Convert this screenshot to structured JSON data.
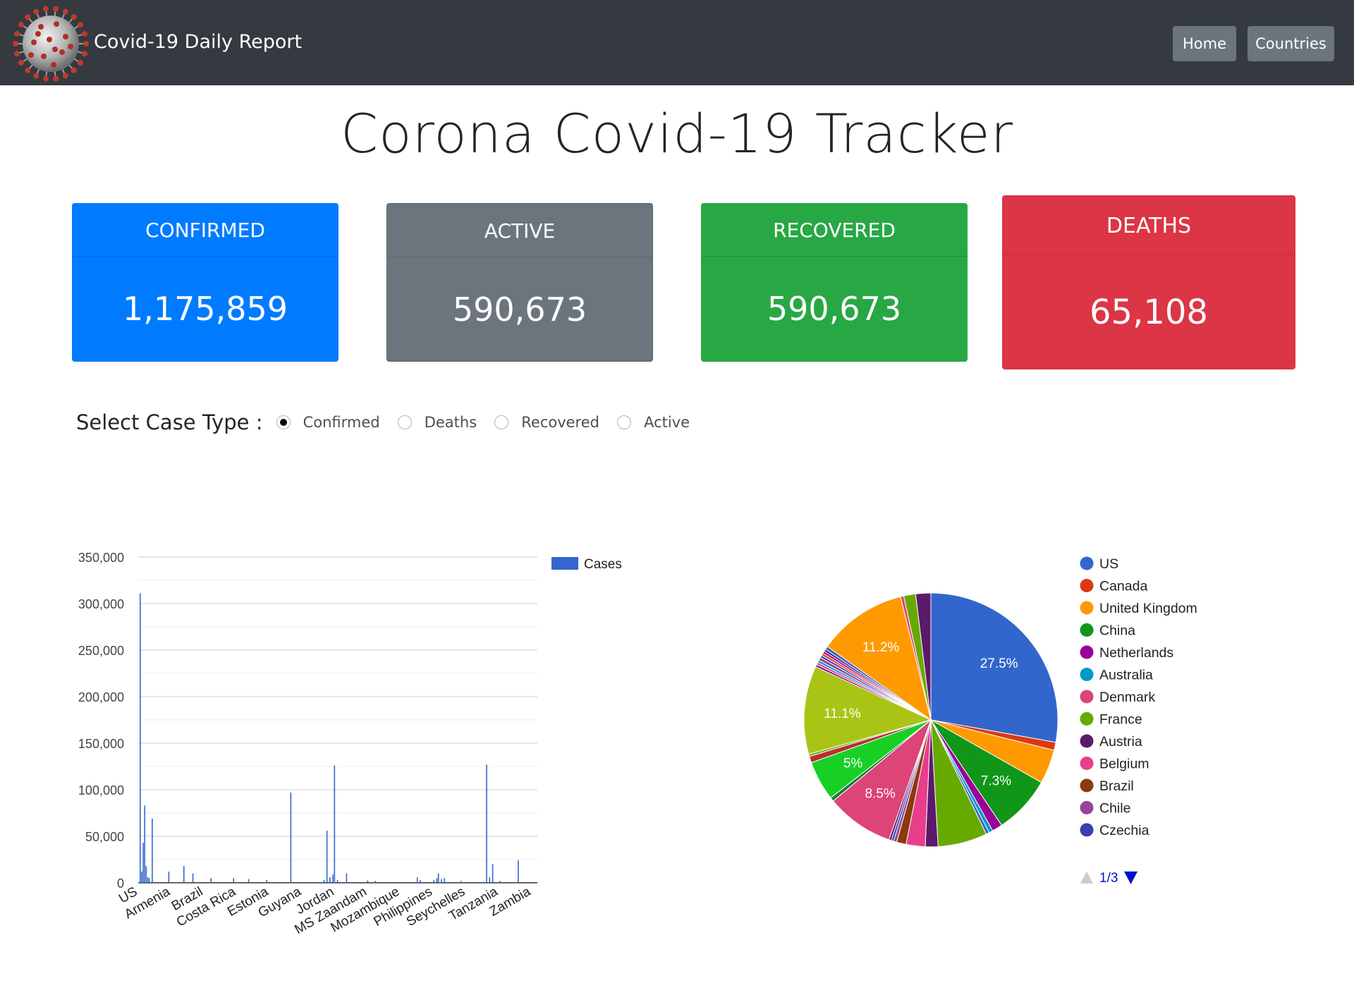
{
  "navbar": {
    "brand": "Covid-19 Daily Report",
    "buttons": [
      {
        "label": "Home"
      },
      {
        "label": "Countries"
      }
    ]
  },
  "page_title": "Corona Covid-19 Tracker",
  "cards": [
    {
      "label": "CONFIRMED",
      "value": "1,175,859",
      "color": "#007bff"
    },
    {
      "label": "ACTIVE",
      "value": "590,673",
      "color": "#6c757d"
    },
    {
      "label": "RECOVERED",
      "value": "590,673",
      "color": "#28a745"
    },
    {
      "label": "DEATHS",
      "value": "65,108",
      "color": "#dc3545"
    }
  ],
  "case_type": {
    "label": "Select Case Type :",
    "options": [
      "Confirmed",
      "Deaths",
      "Recovered",
      "Active"
    ],
    "selected": "Confirmed"
  },
  "chart_data": [
    {
      "type": "bar",
      "series": [
        {
          "name": "Cases",
          "color": "#3366cc"
        }
      ],
      "ylim": [
        0,
        350000
      ],
      "yticks": [
        "0",
        "50,000",
        "100,000",
        "150,000",
        "200,000",
        "250,000",
        "300,000",
        "350,000"
      ],
      "categories_labeled": [
        "US",
        "Armenia",
        "Brazil",
        "Costa Rica",
        "Estonia",
        "Guyana",
        "Jordan",
        "MS Zaandam",
        "Mozambique",
        "Philippines",
        "Seychelles",
        "Tanzania",
        "Zambia"
      ],
      "bar_count": 180,
      "bars": [
        [
          0,
          311000
        ],
        [
          1,
          12000
        ],
        [
          2,
          43000
        ],
        [
          3,
          83000
        ],
        [
          4,
          18000
        ],
        [
          5,
          6000
        ],
        [
          6,
          5000
        ],
        [
          8,
          69000
        ],
        [
          19,
          12000
        ],
        [
          29,
          18000
        ],
        [
          35,
          10000
        ],
        [
          47,
          5000
        ],
        [
          62,
          5000
        ],
        [
          72,
          4000
        ],
        [
          84,
          3000
        ],
        [
          100,
          97000
        ],
        [
          122,
          3000
        ],
        [
          124,
          56000
        ],
        [
          126,
          6000
        ],
        [
          128,
          9000
        ],
        [
          129,
          126000
        ],
        [
          131,
          3000
        ],
        [
          137,
          10000
        ],
        [
          151,
          2500
        ],
        [
          156,
          2000
        ],
        [
          184,
          6000
        ],
        [
          186,
          3000
        ],
        [
          195,
          3000
        ],
        [
          197,
          5000
        ],
        [
          198,
          10000
        ],
        [
          200,
          4000
        ],
        [
          202,
          5000
        ],
        [
          213,
          2000
        ],
        [
          230,
          127000
        ],
        [
          232,
          6000
        ],
        [
          234,
          20000
        ],
        [
          239,
          2000
        ],
        [
          251,
          24000
        ]
      ],
      "bar_total": 265
    },
    {
      "type": "pie",
      "legend": [
        {
          "name": "US",
          "color": "#3366cc"
        },
        {
          "name": "Canada",
          "color": "#dc3912"
        },
        {
          "name": "United Kingdom",
          "color": "#ff9900"
        },
        {
          "name": "China",
          "color": "#109618"
        },
        {
          "name": "Netherlands",
          "color": "#990099"
        },
        {
          "name": "Australia",
          "color": "#0099c6"
        },
        {
          "name": "Denmark",
          "color": "#dd4477"
        },
        {
          "name": "France",
          "color": "#66aa00"
        },
        {
          "name": "Austria",
          "color": "#5c1a6b"
        },
        {
          "name": "Belgium",
          "color": "#e83e8c"
        },
        {
          "name": "Brazil",
          "color": "#8b3a0f"
        },
        {
          "name": "Chile",
          "color": "#994499"
        },
        {
          "name": "Czechia",
          "color": "#3b3eac"
        }
      ],
      "pager": "1/3",
      "slices": [
        {
          "value": 27.5,
          "color": "#3366cc",
          "label": "27.5%"
        },
        {
          "value": 1.0,
          "color": "#dc3912",
          "label": ""
        },
        {
          "value": 4.3,
          "color": "#ff9900",
          "label": ""
        },
        {
          "value": 7.3,
          "color": "#109618",
          "label": "7.3%"
        },
        {
          "value": 1.3,
          "color": "#990099",
          "label": ""
        },
        {
          "value": 0.5,
          "color": "#0099c6",
          "label": ""
        },
        {
          "value": 0.4,
          "color": "#3366cc",
          "label": ""
        },
        {
          "value": 6.2,
          "color": "#66aa00",
          "label": ""
        },
        {
          "value": 1.6,
          "color": "#5c1a6b",
          "label": ""
        },
        {
          "value": 2.4,
          "color": "#e83e8c",
          "label": ""
        },
        {
          "value": 1.2,
          "color": "#8b3a0f",
          "label": ""
        },
        {
          "value": 0.4,
          "color": "#994499",
          "label": ""
        },
        {
          "value": 0.3,
          "color": "#3b3eac",
          "label": ""
        },
        {
          "value": 0.3,
          "color": "#5c1a6b",
          "label": ""
        },
        {
          "value": 8.5,
          "color": "#dd4477",
          "label": "8.5%"
        },
        {
          "value": 0.5,
          "color": "#1a7a3c",
          "label": ""
        },
        {
          "value": 5.0,
          "color": "#18d025",
          "label": "5%"
        },
        {
          "value": 0.8,
          "color": "#b82e2e",
          "label": ""
        },
        {
          "value": 0.3,
          "color": "#66aa00",
          "label": ""
        },
        {
          "value": 11.1,
          "color": "#aac416",
          "label": "11.1%"
        },
        {
          "value": 0.3,
          "color": "#990099",
          "label": ""
        },
        {
          "value": 0.3,
          "color": "#dd4477",
          "label": ""
        },
        {
          "value": 0.3,
          "color": "#0099c6",
          "label": ""
        },
        {
          "value": 0.4,
          "color": "#994499",
          "label": ""
        },
        {
          "value": 0.3,
          "color": "#3b3eac",
          "label": ""
        },
        {
          "value": 0.3,
          "color": "#dc3912",
          "label": ""
        },
        {
          "value": 0.3,
          "color": "#990099",
          "label": ""
        },
        {
          "value": 0.3,
          "color": "#5c1a6b",
          "label": ""
        },
        {
          "value": 0.4,
          "color": "#3366cc",
          "label": ""
        },
        {
          "value": 11.2,
          "color": "#ff9900",
          "label": "11.2%"
        },
        {
          "value": 0.4,
          "color": "#dd4477",
          "label": ""
        },
        {
          "value": 1.5,
          "color": "#66aa00",
          "label": ""
        },
        {
          "value": 1.9,
          "color": "#5c1a6b",
          "label": ""
        }
      ]
    }
  ]
}
